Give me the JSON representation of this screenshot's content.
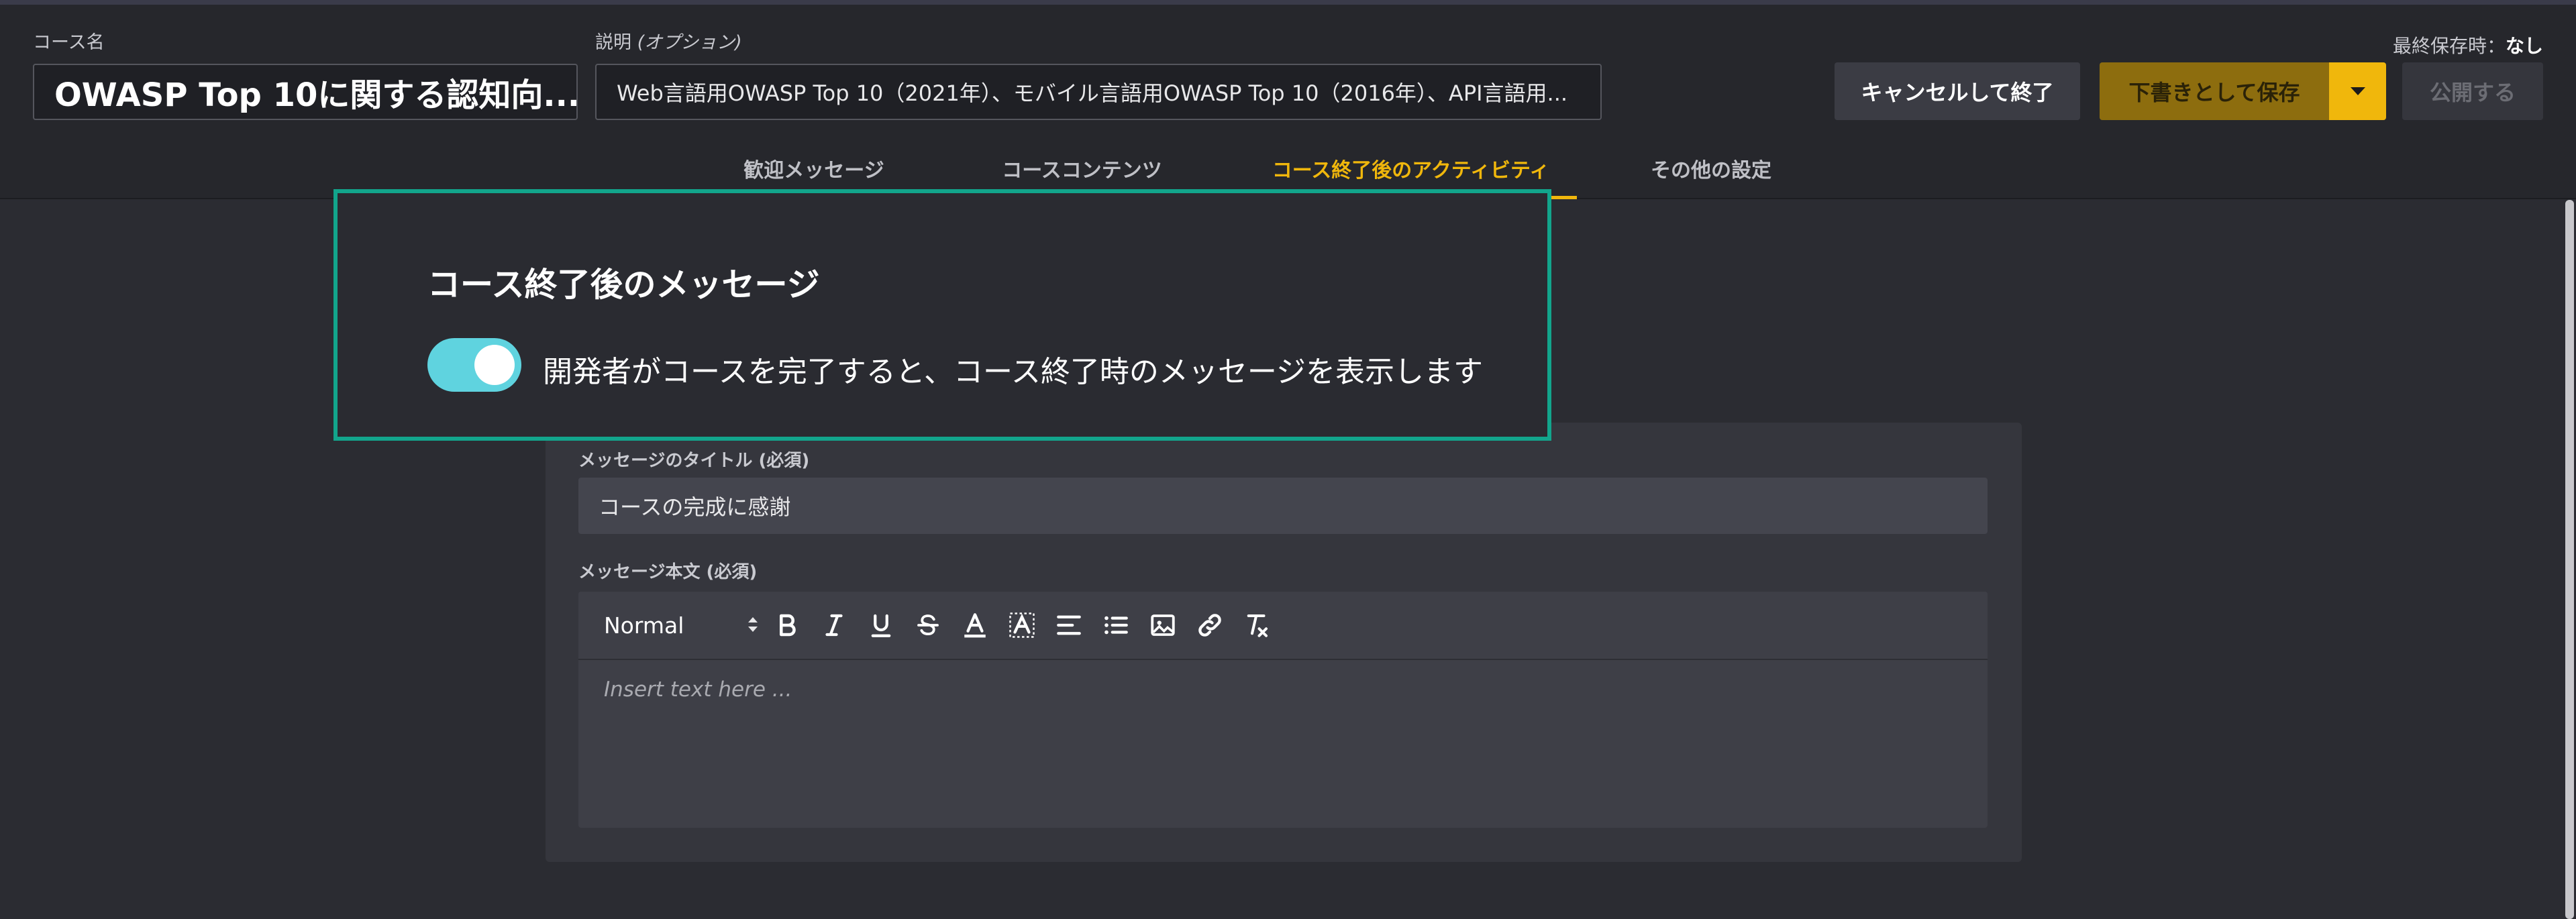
{
  "header": {
    "course_name_label": "コース名",
    "course_name_value": "OWASP Top 10に関する認知向...",
    "description_label": "説明",
    "description_optional": "(オプション)",
    "description_value": "Web言語用OWASP Top 10（2021年）、モバイル言語用OWASP Top 10（2016年）、API言語用...",
    "last_saved_label": "最終保存時：",
    "last_saved_value": "なし",
    "cancel_button": "キャンセルして終了",
    "save_draft_button": "下書きとして保存",
    "publish_button": "公開する"
  },
  "tabs": [
    {
      "label": "歓迎メッセージ",
      "active": false
    },
    {
      "label": "コースコンテンツ",
      "active": false
    },
    {
      "label": "コース終了後のアクティビティ",
      "active": true
    },
    {
      "label": "その他の設定",
      "active": false
    }
  ],
  "post_course": {
    "section_title": "コース終了後のメッセージ",
    "toggle_on": true,
    "toggle_label": "開発者がコースを完了すると、コース終了時のメッセージを表示します",
    "message_title_label": "メッセージのタイトル (必須)",
    "message_title_value": "コースの完成に感謝",
    "message_body_label": "メッセージ本文 (必須)",
    "editor_format_value": "Normal",
    "editor_placeholder": "Insert text here ..."
  },
  "toolbar_icons": [
    "bold-icon",
    "italic-icon",
    "underline-icon",
    "strikethrough-icon",
    "font-color-icon",
    "background-color-icon",
    "align-icon",
    "bullet-list-icon",
    "image-icon",
    "link-icon",
    "clear-format-icon"
  ],
  "colors": {
    "accent": "#f0b70c",
    "highlight_border": "#12a58c",
    "toggle_on": "#5fd3df",
    "background": "#2b2c32"
  }
}
